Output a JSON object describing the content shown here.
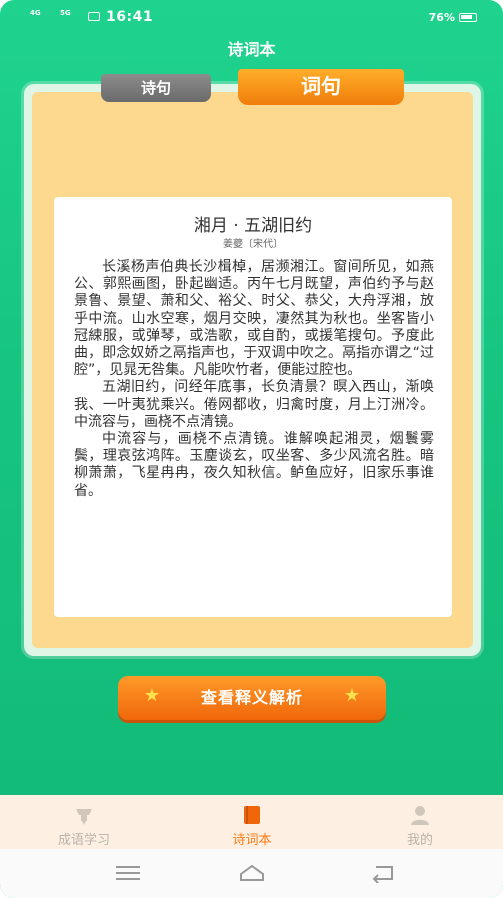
{
  "status": {
    "signal1": "4G",
    "signal2": "5G",
    "time": "16:41",
    "battery": "76%"
  },
  "app": {
    "title": "诗词本"
  },
  "tabs": [
    {
      "label": "诗句",
      "active": false
    },
    {
      "label": "词句",
      "active": true
    }
  ],
  "poem": {
    "title": "湘月 · 五湖旧约",
    "author": "姜夔〔宋代〕",
    "paragraphs": [
      "长溪杨声伯典长沙楫棹，居濒湘江。窗间所见，如燕公、郭熙画图，卧起幽适。丙午七月既望，声伯约予与赵景鲁、景望、萧和父、裕父、时父、恭父，大舟浮湘，放乎中流。山水空寒，烟月交映，凄然其为秋也。坐客皆小冠綀服，或弹琴，或浩歌，或自酌，或援笔搜句。予度此曲，即念奴娇之鬲指声也，于双调中吹之。鬲指亦谓之“过腔”，见晁无咎集。凡能吹竹者，便能过腔也。",
      "五湖旧约，问经年底事，长负清景？暝入西山，渐唤我、一叶夷犹乘兴。倦网都收，归禽时度，月上汀洲冷。中流容与，画桡不点清镜。",
      "中流容与，画桡不点清镜。谁解唤起湘灵，烟鬟雾鬓，理哀弦鸿阵。玉麈谈玄，叹坐客、多少风流名胜。暗柳萧萧，飞星冉冉，夜久知秋信。鲈鱼应好，旧家乐事谁省。"
    ]
  },
  "action": {
    "label": "查看释义解析"
  },
  "nav": [
    {
      "label": "成语学习",
      "icon": "pen-icon",
      "active": false
    },
    {
      "label": "诗词本",
      "icon": "book-icon",
      "active": true
    },
    {
      "label": "我的",
      "icon": "user-icon",
      "active": false
    }
  ],
  "colors": {
    "brand_green": "#17c581",
    "accent_orange": "#f07d0a",
    "panel_yellow": "#fcd98f"
  }
}
